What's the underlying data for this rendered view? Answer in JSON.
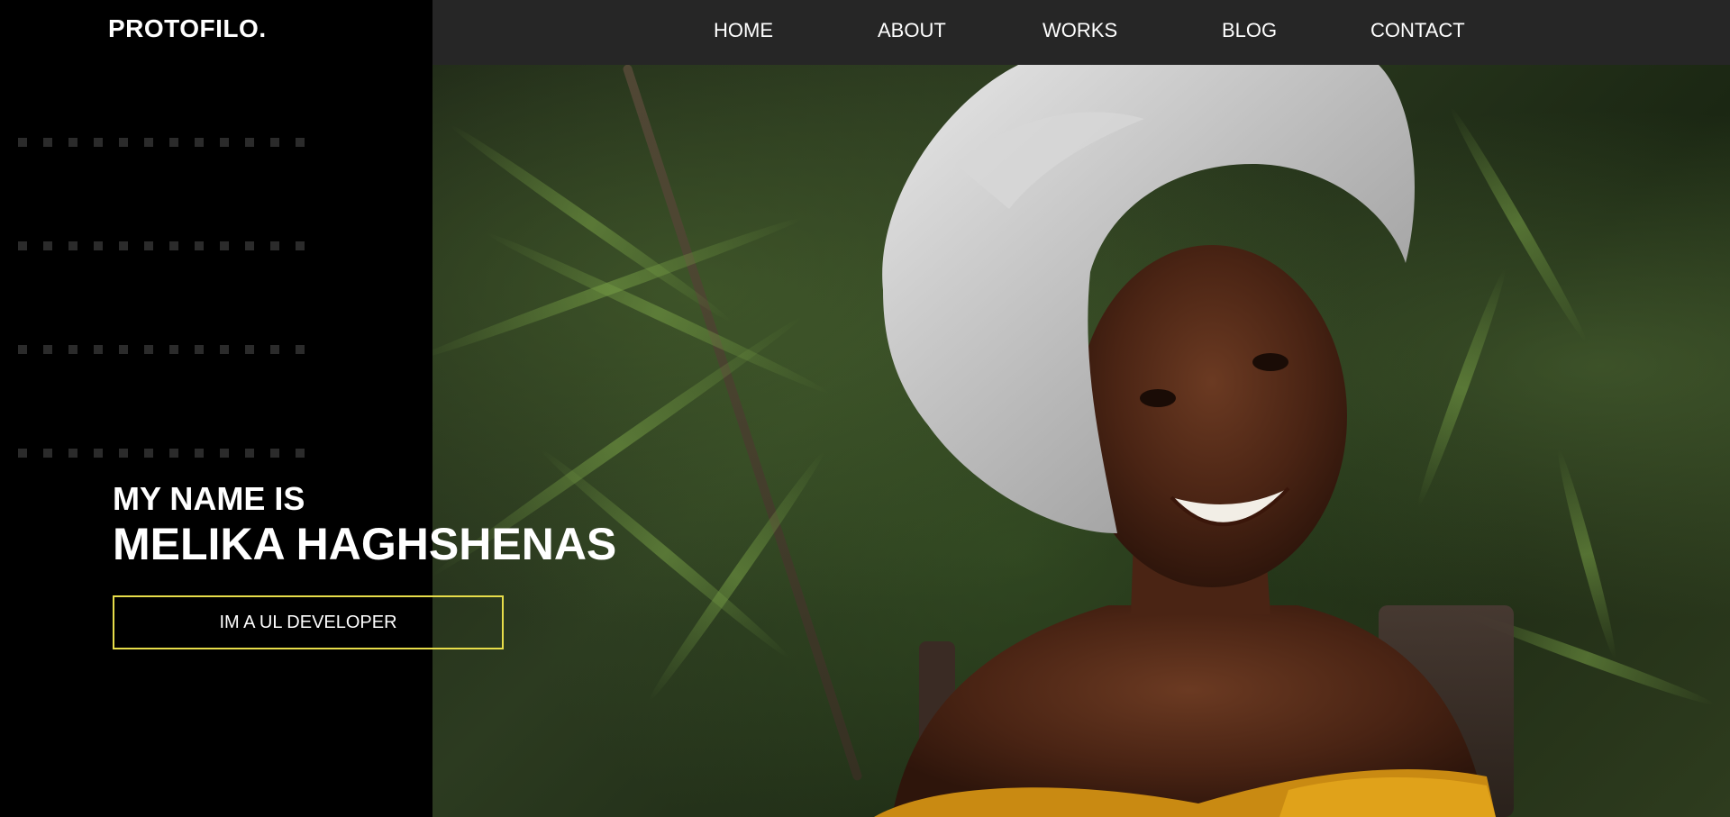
{
  "header": {
    "logo": "PROTOFILO.",
    "nav": [
      "HOME",
      "ABOUT",
      "WORKS",
      "BLOG",
      "CONTACT"
    ]
  },
  "hero": {
    "intro": "MY NAME IS",
    "name": "MELIKA HAGHSHENAS",
    "role_button": "IM A UL DEVELOPER"
  },
  "colors": {
    "background": "#000000",
    "topbar": "#262626",
    "accent_border": "#e7dd4a",
    "text": "#ffffff"
  }
}
